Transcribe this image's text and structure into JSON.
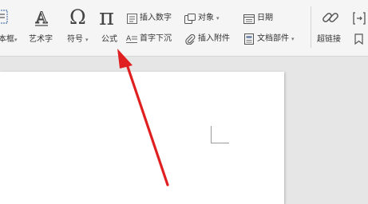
{
  "ribbon": {
    "textbox_label": "本框",
    "wordart_label": "艺术字",
    "symbol_label": "符号",
    "formula_label": "公式",
    "insert_number_label": "插入数字",
    "drop_cap_label": "首字下沉",
    "object_label": "对象",
    "attachment_label": "插入附件",
    "date_label": "日期",
    "doc_parts_label": "文档部件",
    "hyperlink_label": "超链接",
    "symbol_glyph": "Ω",
    "formula_glyph": "π"
  },
  "colors": {
    "arrow": "#e02020",
    "ribbon_bg": "#f5f5f5",
    "workspace_bg": "#e6e6e6",
    "page_bg": "#ffffff"
  }
}
